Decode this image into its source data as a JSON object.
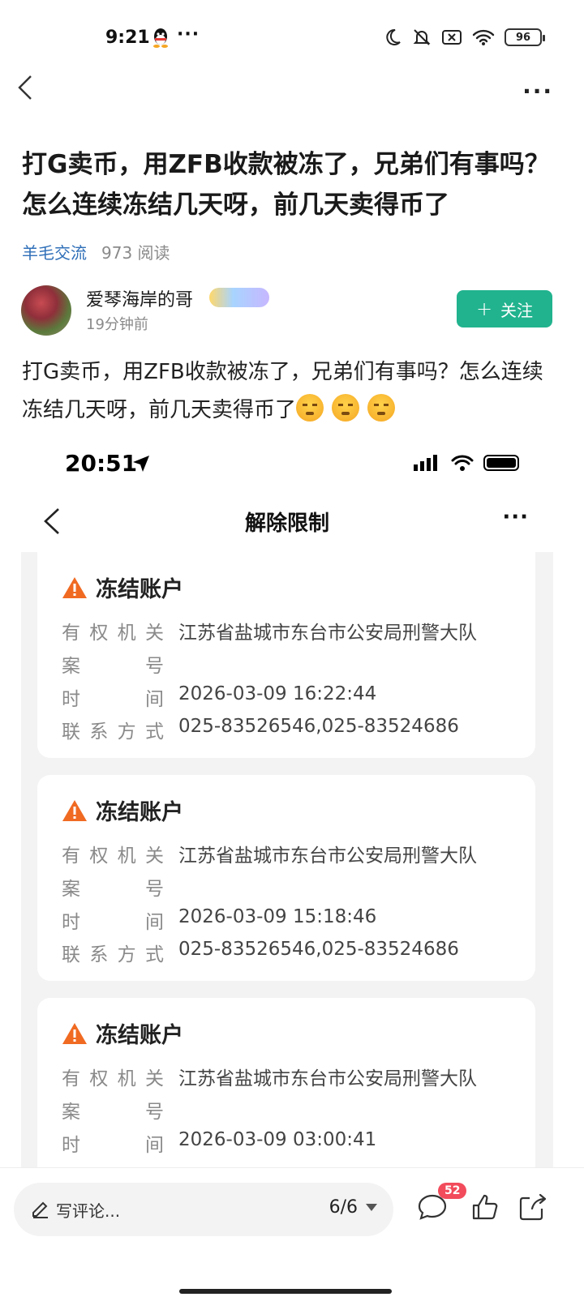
{
  "status_bar": {
    "time": "9:21",
    "dots": "···",
    "battery": "96"
  },
  "nav": {
    "more": "···"
  },
  "post": {
    "title": "打G卖币，用ZFB收款被冻了，兄弟们有事吗？怎么连续冻结几天呀，前几天卖得币了",
    "topic": "羊毛交流",
    "reads": "973 阅读",
    "author": "爱琴海岸的哥",
    "time": "19分钟前",
    "follow_label": "关注",
    "body": "打G卖币，用ZFB收款被冻了，兄弟们有事吗？怎么连续冻结几天呀，前几天卖得币了"
  },
  "screenshot": {
    "time": "20:51",
    "title": "解除限制",
    "more": "···",
    "labels": {
      "authority": [
        "有",
        "权",
        "机",
        "关"
      ],
      "case": [
        "案",
        "号"
      ],
      "time": [
        "时",
        "间"
      ],
      "contact": [
        "联",
        "系",
        "方",
        "式"
      ]
    },
    "cards": [
      {
        "title": "冻结账户",
        "authority": "江苏省盐城市东台市公安局刑警大队",
        "case": "",
        "time": "2026-03-09 16:22:44",
        "contact": "025-83526546,025-83524686"
      },
      {
        "title": "冻结账户",
        "authority": "江苏省盐城市东台市公安局刑警大队",
        "case": "",
        "time": "2026-03-09 15:18:46",
        "contact": "025-83526546,025-83524686"
      },
      {
        "title": "冻结账户",
        "authority": "江苏省盐城市东台市公安局刑警大队",
        "case": "",
        "time": "2026-03-09 03:00:41",
        "contact": ""
      }
    ]
  },
  "bottom_bar": {
    "comment_placeholder": "写评论...",
    "page_indicator": "6/6",
    "comment_count": "52"
  },
  "colors": {
    "accent": "#21b38e",
    "topic": "#2f6fb8",
    "warning": "#f06a22",
    "badge": "#f24b5b"
  }
}
